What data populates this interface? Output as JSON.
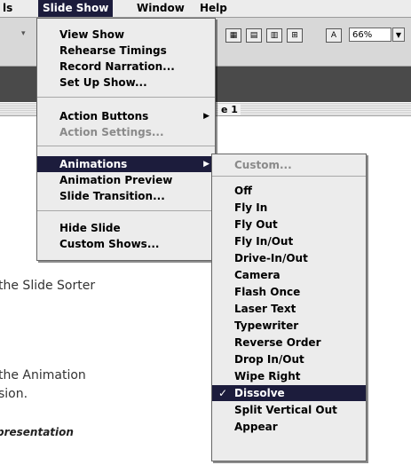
{
  "menubar": {
    "items": [
      {
        "label": "ls"
      },
      {
        "label": "Slide Show"
      },
      {
        "label": "Window"
      },
      {
        "label": "Help"
      }
    ]
  },
  "toolbar": {
    "zoom_value": "66%"
  },
  "window": {
    "title_fragment": "e 1"
  },
  "slide_show_menu": {
    "groups": [
      [
        "View Show",
        "Rehearse Timings",
        "Record Narration...",
        "Set Up Show..."
      ],
      [
        "Action Buttons",
        "Action Settings..."
      ],
      [
        "Animations",
        "Animation Preview",
        "Slide Transition..."
      ],
      [
        "Hide Slide",
        "Custom Shows..."
      ]
    ],
    "disabled": [
      "Action Settings..."
    ],
    "highlighted": "Animations",
    "submenu_parents": [
      "Action Buttons",
      "Animations"
    ]
  },
  "animations_menu": {
    "items": [
      "Custom...",
      "Off",
      "Fly In",
      "Fly Out",
      "Fly In/Out",
      "Drive-In/Out",
      "Camera",
      "Flash Once",
      "Laser Text",
      "Typewriter",
      "Reverse Order",
      "Drop In/Out",
      "Wipe Right",
      "Dissolve",
      "Split Vertical Out",
      "Appear"
    ],
    "disabled": [
      "Custom..."
    ],
    "checked": "Dissolve",
    "check_mark": "✓"
  },
  "document": {
    "lines": [
      "the Slide Sorter",
      "the Animation",
      "sion.",
      "presentation"
    ]
  },
  "colors": {
    "highlight": "#1c1c3c",
    "menu_bg": "#ececec",
    "disabled_text": "#8a8a8a"
  }
}
